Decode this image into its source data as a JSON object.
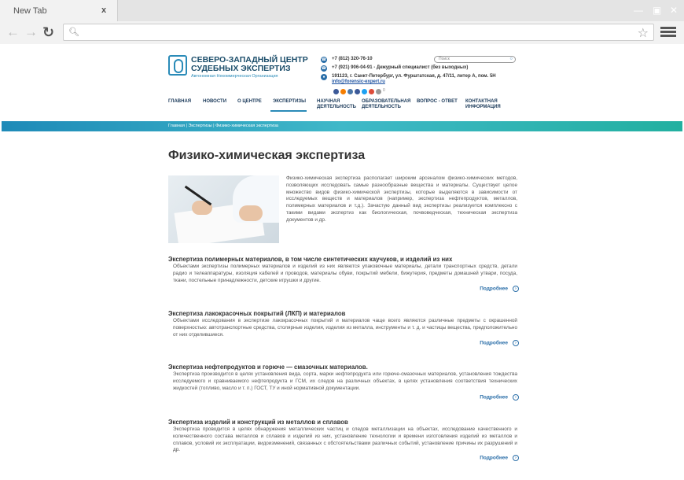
{
  "browser": {
    "tab_title": "New Tab",
    "tab_close": "x"
  },
  "site": {
    "logo_title": "СЕВЕРО-ЗАПАДНЫЙ ЦЕНТР СУДЕБНЫХ ЭКСПЕРТИЗ",
    "logo_subtitle": "Автономная Некоммерческая Организация",
    "phone1": "+7 (812) 320-76-10",
    "phone2": "+7 (921) 906-04-91 - Дежурный специалист (без выходных)",
    "address": "191123, г. Санкт-Петербург, ул. Фурштатская, д. 47/11, литер А, пом. 5Н",
    "email": "info@forensic-expert.ru",
    "search_placeholder": "Поиск",
    "social_count": "0",
    "social_colors": [
      "#3b5998",
      "#f57d00",
      "#4a76a8",
      "#3b5998",
      "#1da1f2",
      "#dd4b39"
    ]
  },
  "nav": {
    "items": [
      "ГЛАВНАЯ",
      "НОВОСТИ",
      "О ЦЕНТРЕ",
      "ЭКСПЕРТИЗЫ",
      "НАУЧНАЯ ДЕЯТЕЛЬНОСТЬ",
      "ОБРАЗОВАТЕЛЬНАЯ ДЕЯТЕЛЬНОСТЬ",
      "ВОПРОС - ОТВЕТ",
      "КОНТАКТНАЯ ИНФОРМАЦИЯ"
    ],
    "active": "ЭКСПЕРТИЗЫ"
  },
  "breadcrumb": "Главная | Экспертизы | Физико-химическая экспертиза",
  "page_title": "Физико-химическая экспертиза",
  "intro": "Физико-химическая экспертиза располагает широким арсеналом физико-химических методов, позволяющих исследовать самые разнообразные вещества и материалы. Существует целое множество видов физико-химической экспертизы, которые выделяются в зависимости от исследуемых веществ и материалов (например, экспертиза нефтепродуктов, металлов, полимерных материалов и т.д.). Зачастую данный вид экспертизы реализуется комплексно с такими видами экспертиз как биологическая, почвоведческая, техническая экспертиза документов и др.",
  "more_label": "Подробнее",
  "sections": [
    {
      "title": "Экспертиза полимерных материалов, в том числе синтетических каучуков, и изделий из них",
      "text": "Объектами экспертизы полимерных материалов и изделий из них являются упаковочные материалы, детали транспортных средств, детали радио и телеаппаратуры, изоляция кабелей и проводов, материалы обуви, покрытий мебели, бижутерия, предметы домашней утвари, посуда, ткани, постельные принадлежности, детские игрушки и другие."
    },
    {
      "title": "Экспертиза лакокрасочных покрытий (ЛКП) и материалов",
      "text": "Объектами исследования в экспертизе лакокрасочных покрытий и материалов чаще всего являются различные предметы с окрашенной поверхностью: автотранспортные средства, столярные изделия, изделия из металла, инструменты и т. д. и частицы вещества, предположительно от них отделившиеся."
    },
    {
      "title": "Экспертиза нефтепродуктов и горюче — смазочных материалов.",
      "text": "Экспертиза производится в целях установления вида, сорта, марки нефтепродукта или горюче-смазочных материалов, установления тождества исследуемого и сравниваемого нефтепродукта и ГСМ, их следов на различных объектах, в целях установления соответствия технических жидкостей (топливо, масло и т. п.) ГОСТ, ТУ и иной нормативной документации."
    },
    {
      "title": "Экспертиза изделий и конструкций из металлов и сплавов",
      "text": "Экспертиза проводится в целях обнаружения металлических частиц и следов металлизации на объектах, исследование качественного и количественного состава металлов и сплавов и изделий из них, установление технологии и времени изготовления изделий из металлов и сплавов, условий их эксплуатации, видоизменений, связанных с обстоятельствами различных событий, установление причины их разрушений и др."
    }
  ]
}
